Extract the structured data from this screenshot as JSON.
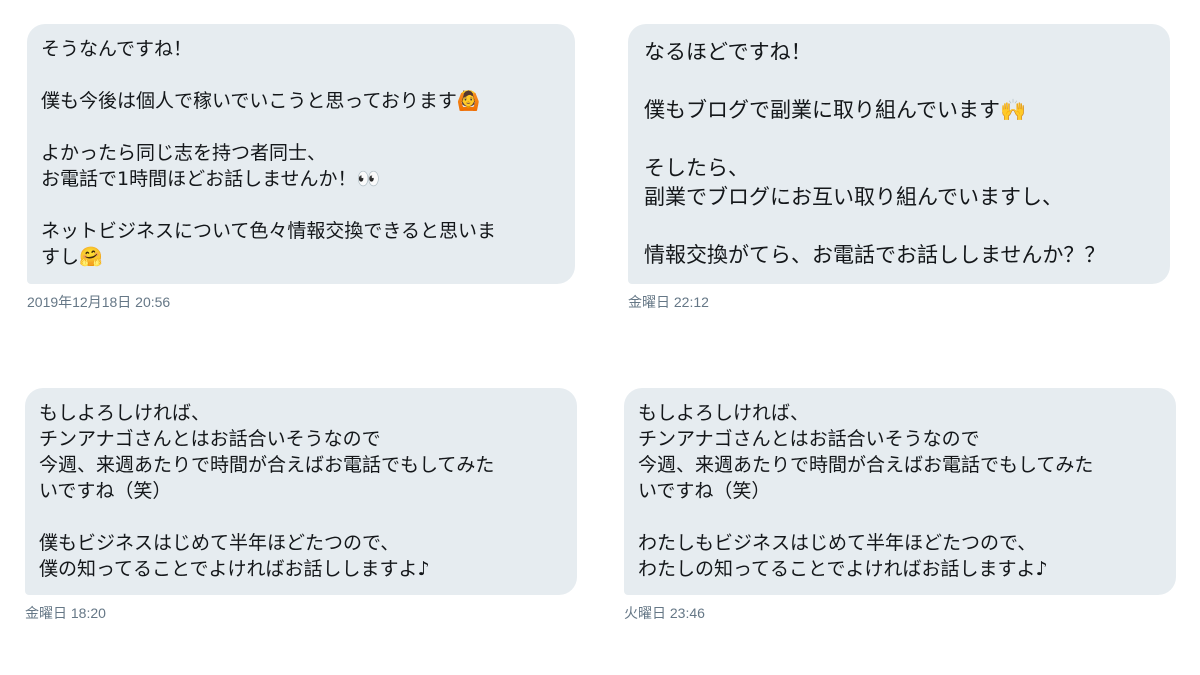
{
  "messages": [
    {
      "lines": [
        "そうなんですね！",
        "",
        "僕も今後は個人で稼いでいこうと思っております🙆",
        "",
        "よかったら同じ志を持つ者同士、",
        "お電話で1時間ほどお話しませんか！👀",
        "",
        "ネットビジネスについて色々情報交換できると思いま",
        "すし🤗"
      ],
      "timestamp": "2019年12月18日 20:56"
    },
    {
      "lines": [
        "なるほどですね！",
        "",
        "僕もブログで副業に取り組んでいます🙌",
        "",
        "そしたら、",
        "副業でブログにお互い取り組んでいますし、",
        "",
        "情報交換がてら、お電話でお話ししませんか？？"
      ],
      "timestamp": "金曜日 22:12"
    },
    {
      "lines": [
        "もしよろしければ、",
        "チンアナゴさんとはお話合いそうなので",
        "今週、来週あたりで時間が合えばお電話でもしてみた",
        "いですね（笑）",
        "",
        "僕もビジネスはじめて半年ほどたつので、",
        "僕の知ってることでよければお話ししますよ♪"
      ],
      "timestamp": "金曜日 18:20"
    },
    {
      "lines": [
        "もしよろしければ、",
        "チンアナゴさんとはお話合いそうなので",
        "今週、来週あたりで時間が合えばお電話でもしてみた",
        "いですね（笑）",
        "",
        "わたしもビジネスはじめて半年ほどたつので、",
        "わたしの知ってることでよければお話しますよ♪"
      ],
      "timestamp": "火曜日 23:46"
    }
  ],
  "colors": {
    "bubble_background": "#e6ecf0",
    "text": "#14171a",
    "timestamp": "#657786"
  }
}
